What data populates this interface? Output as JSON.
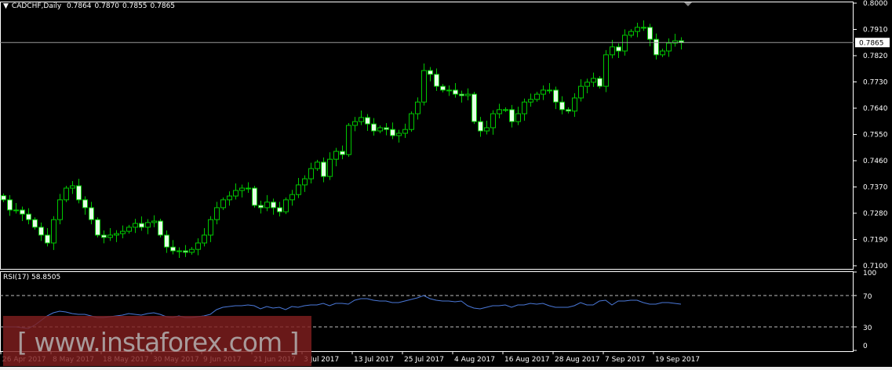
{
  "header": {
    "symbol": "CADCHF,Daily",
    "open": "0.7864",
    "high": "0.7870",
    "low": "0.7855",
    "close": "0.7865"
  },
  "rsi_header": {
    "name": "RSI(17)",
    "value": "58.8505"
  },
  "watermark": "[ www.instaforex.com ]",
  "colors": {
    "background": "#000000",
    "candle": "#00c800",
    "bear_fill": "#e6ffe6",
    "rsi_line": "#4a78d8",
    "grid": "#ffffff"
  },
  "chart_data": [
    {
      "type": "candlestick",
      "title": "CADCHF,Daily",
      "ylim": [
        0.71,
        0.8
      ],
      "yticks": [
        "0.8000",
        "0.7910",
        "0.7820",
        "0.7730",
        "0.7640",
        "0.7550",
        "0.7460",
        "0.7370",
        "0.7280",
        "0.7190",
        "0.7100"
      ],
      "current_price": "0.7865",
      "first_open": 0.734,
      "closes": [
        0.7326,
        0.7291,
        0.7291,
        0.7277,
        0.7258,
        0.7232,
        0.7205,
        0.7178,
        0.7258,
        0.7326,
        0.7366,
        0.7374,
        0.7326,
        0.7299,
        0.7258,
        0.7205,
        0.7197,
        0.7205,
        0.721,
        0.7218,
        0.7232,
        0.7245,
        0.7232,
        0.7248,
        0.7253,
        0.7205,
        0.7164,
        0.7151,
        0.7151,
        0.7146,
        0.7156,
        0.7178,
        0.7205,
        0.7258,
        0.7299,
        0.7326,
        0.7339,
        0.7358,
        0.7366,
        0.7366,
        0.7307,
        0.7299,
        0.7318,
        0.7299,
        0.7285,
        0.7326,
        0.7344,
        0.7377,
        0.7398,
        0.7433,
        0.7455,
        0.7406,
        0.7465,
        0.7492,
        0.7481,
        0.7581,
        0.7594,
        0.7608,
        0.7586,
        0.7562,
        0.7573,
        0.7567,
        0.7546,
        0.7554,
        0.7567,
        0.7621,
        0.7661,
        0.7769,
        0.7756,
        0.7715,
        0.7702,
        0.7702,
        0.7688,
        0.7683,
        0.7688,
        0.7594,
        0.7562,
        0.7573,
        0.7621,
        0.7635,
        0.7635,
        0.7594,
        0.7621,
        0.7661,
        0.767,
        0.7688,
        0.7702,
        0.7702,
        0.7661,
        0.7635,
        0.763,
        0.7675,
        0.7715,
        0.7729,
        0.7742,
        0.7715,
        0.7823,
        0.785,
        0.7836,
        0.789,
        0.7903,
        0.7917,
        0.7917,
        0.7876,
        0.7823,
        0.7836,
        0.7863,
        0.7871,
        0.7865
      ],
      "xticks": [
        "26 Apr 2017",
        "8 May 2017",
        "18 May 2017",
        "30 May 2017",
        "9 Jun 2017",
        "21 Jun 2017",
        "3 Jul 2017",
        "13 Jul 2017",
        "25 Jul 2017",
        "4 Aug 2017",
        "16 Aug 2017",
        "28 Aug 2017",
        "7 Sep 2017",
        "19 Sep 2017"
      ]
    },
    {
      "type": "line",
      "title": "RSI(17)",
      "ylim": [
        0,
        100
      ],
      "yticks": [
        "100",
        "70",
        "30",
        "0"
      ],
      "levels": [
        70,
        30
      ],
      "values": [
        30,
        30,
        30,
        29,
        28,
        32,
        38,
        44,
        48,
        50,
        49,
        47,
        46,
        46,
        44,
        42,
        42,
        43,
        44,
        45,
        47,
        46,
        45,
        47,
        48,
        46,
        43,
        42,
        44,
        42,
        42,
        43,
        44,
        46,
        52,
        55,
        56,
        57,
        57,
        58,
        57,
        53,
        56,
        54,
        55,
        52,
        56,
        55,
        57,
        58,
        58,
        60,
        57,
        60,
        60,
        59,
        64,
        66,
        66,
        64,
        63,
        63,
        61,
        61,
        63,
        65,
        67,
        70,
        66,
        64,
        63,
        63,
        62,
        63,
        57,
        54,
        53,
        55,
        57,
        57,
        58,
        55,
        58,
        58,
        60,
        59,
        60,
        57,
        55,
        55,
        55,
        57,
        61,
        58,
        58,
        63,
        64,
        58,
        63,
        63,
        64,
        64,
        61,
        59,
        59,
        61,
        61,
        60,
        59
      ]
    }
  ]
}
